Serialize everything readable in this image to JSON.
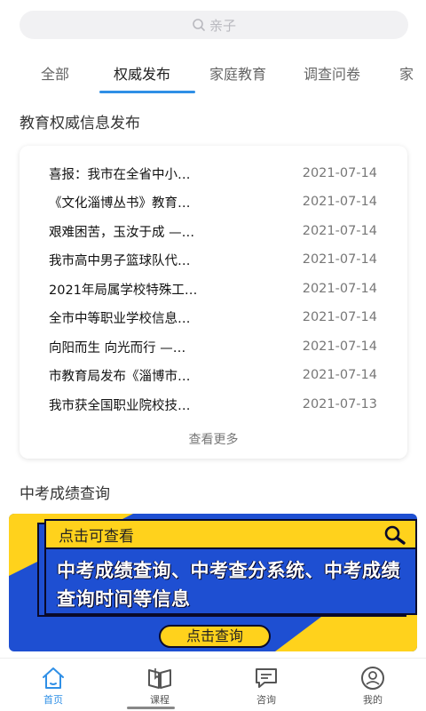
{
  "search": {
    "placeholder": "亲子"
  },
  "tabs": [
    {
      "label": "全部"
    },
    {
      "label": "权威发布"
    },
    {
      "label": "家庭教育"
    },
    {
      "label": "调查问卷"
    },
    {
      "label": "家"
    }
  ],
  "news_section": {
    "title": "教育权威信息发布",
    "items": [
      {
        "title": "喜报：我市在全省中小…",
        "date": "2021-07-14"
      },
      {
        "title": "《文化淄博丛书》教育…",
        "date": "2021-07-14"
      },
      {
        "title": "艰难困苦，玉汝于成 —…",
        "date": "2021-07-14"
      },
      {
        "title": "我市高中男子篮球队代…",
        "date": "2021-07-14"
      },
      {
        "title": "2021年局属学校特殊工…",
        "date": "2021-07-14"
      },
      {
        "title": "全市中等职业学校信息…",
        "date": "2021-07-14"
      },
      {
        "title": "向阳而生 向光而行 —…",
        "date": "2021-07-14"
      },
      {
        "title": "市教育局发布《淄博市…",
        "date": "2021-07-14"
      },
      {
        "title": "我市获全国职业院校技…",
        "date": "2021-07-13"
      }
    ],
    "more_label": "查看更多"
  },
  "score_section": {
    "title": "中考成绩查询",
    "banner_header": "点击可查看",
    "banner_text": "中考成绩查询、中考查分系统、中考成绩查询时间等信息",
    "banner_button": "点击查询"
  },
  "bottom_nav": [
    {
      "label": "首页",
      "icon": "home-icon"
    },
    {
      "label": "课程",
      "icon": "book-icon"
    },
    {
      "label": "咨询",
      "icon": "chat-icon"
    },
    {
      "label": "我的",
      "icon": "user-icon"
    }
  ],
  "colors": {
    "accent": "#2f8fe6",
    "banner_blue": "#1e4fd2",
    "banner_yellow": "#ffd21c"
  }
}
